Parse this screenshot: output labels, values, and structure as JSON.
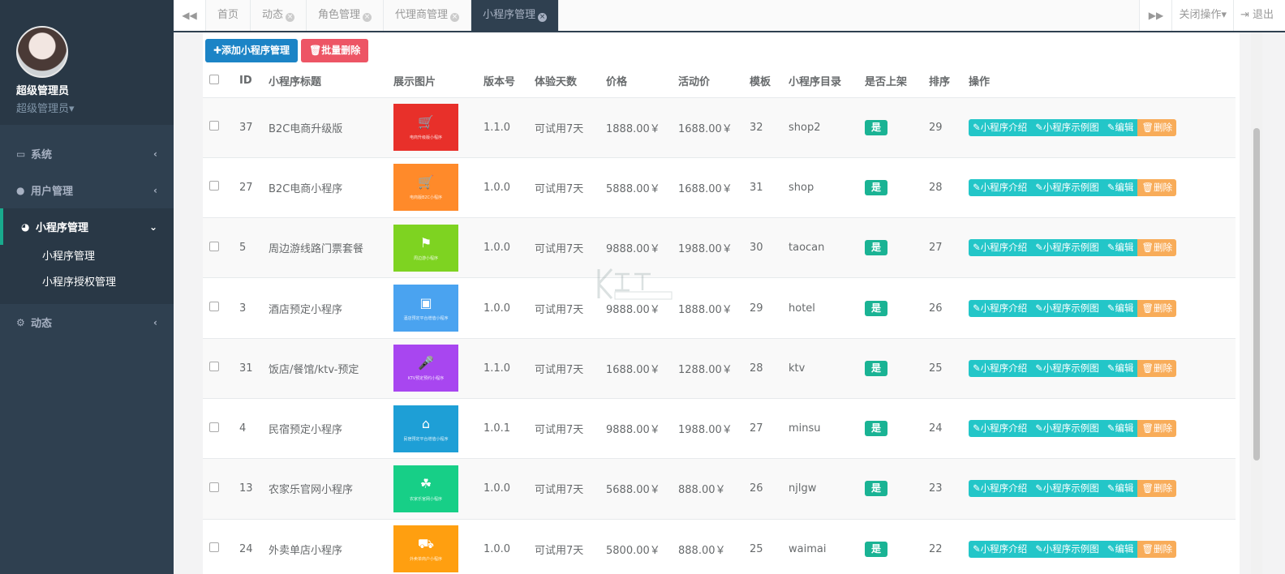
{
  "profile": {
    "name": "超级管理员",
    "role": "超级管理员▾"
  },
  "sidebar": {
    "items": [
      {
        "label": "系统",
        "icon": "monitor-icon"
      },
      {
        "label": "用户管理",
        "icon": "user-icon"
      },
      {
        "label": "小程序管理",
        "icon": "wechat-icon"
      },
      {
        "label": "动态",
        "icon": "cogs-icon"
      }
    ],
    "sub_items": [
      "小程序管理",
      "小程序授权管理"
    ]
  },
  "tabs": [
    {
      "label": "首页",
      "closable": false
    },
    {
      "label": "动态",
      "closable": true
    },
    {
      "label": "角色管理",
      "closable": true
    },
    {
      "label": "代理商管理",
      "closable": true
    },
    {
      "label": "小程序管理",
      "closable": true
    }
  ],
  "topbar": {
    "close_ops": "关闭操作▾",
    "logout": "退出"
  },
  "toolbar": {
    "add": "✚添加小程序管理",
    "batch_delete": "🗑批量删除"
  },
  "table": {
    "columns": [
      "ID",
      "小程序标题",
      "展示图片",
      "版本号",
      "体验天数",
      "价格",
      "活动价",
      "模板",
      "小程序目录",
      "是否上架",
      "排序",
      "操作"
    ],
    "actions": {
      "intro": "✎小程序介绍",
      "example": "✎小程序示例图",
      "edit": "✎编辑",
      "delete": "🗑删除"
    },
    "rows": [
      {
        "id": "37",
        "title": "B2C电商升级版",
        "thumb_color": "#e8302a",
        "thumb_caption": "电商升级版小程序",
        "version": "1.1.0",
        "trial": "可试用7天",
        "price": "1888.00￥",
        "promo": "1688.00￥",
        "template": "32",
        "dir": "shop2",
        "listed": "是",
        "sort": "29"
      },
      {
        "id": "27",
        "title": "B2C电商小程序",
        "thumb_color": "#ff8a2a",
        "thumb_caption": "电商版B2C小程序",
        "version": "1.0.0",
        "trial": "可试用7天",
        "price": "5888.00￥",
        "promo": "1688.00￥",
        "template": "31",
        "dir": "shop",
        "listed": "是",
        "sort": "28"
      },
      {
        "id": "5",
        "title": "周边游线路门票套餐",
        "thumb_color": "#7ed321",
        "thumb_caption": "周边游小程序",
        "version": "1.0.0",
        "trial": "可试用7天",
        "price": "9888.00￥",
        "promo": "1988.00￥",
        "template": "30",
        "dir": "taocan",
        "listed": "是",
        "sort": "27"
      },
      {
        "id": "3",
        "title": "酒店预定小程序",
        "thumb_color": "#4aa3f0",
        "thumb_caption": "酒店预定平台增值小程序",
        "version": "1.0.0",
        "trial": "可试用7天",
        "price": "9888.00￥",
        "promo": "1888.00￥",
        "template": "29",
        "dir": "hotel",
        "listed": "是",
        "sort": "26"
      },
      {
        "id": "31",
        "title": "饭店/餐馆/ktv-预定",
        "thumb_color": "#a846f0",
        "thumb_caption": "KTV预定预约小程序",
        "version": "1.1.0",
        "trial": "可试用7天",
        "price": "1688.00￥",
        "promo": "1288.00￥",
        "template": "28",
        "dir": "ktv",
        "listed": "是",
        "sort": "25"
      },
      {
        "id": "4",
        "title": "民宿预定小程序",
        "thumb_color": "#1e9fd6",
        "thumb_caption": "民宿预定平台增值小程序",
        "version": "1.0.1",
        "trial": "可试用7天",
        "price": "9888.00￥",
        "promo": "1988.00￥",
        "template": "27",
        "dir": "minsu",
        "listed": "是",
        "sort": "24"
      },
      {
        "id": "13",
        "title": "农家乐官网小程序",
        "thumb_color": "#17cf87",
        "thumb_caption": "农家乐官网小程序",
        "version": "1.0.0",
        "trial": "可试用7天",
        "price": "5688.00￥",
        "promo": "888.00￥",
        "template": "26",
        "dir": "njlgw",
        "listed": "是",
        "sort": "23"
      },
      {
        "id": "24",
        "title": "外卖单店小程序",
        "thumb_color": "#ff9f10",
        "thumb_caption": "外卖单商户小程序",
        "version": "1.0.0",
        "trial": "可试用7天",
        "price": "5800.00￥",
        "promo": "888.00￥",
        "template": "25",
        "dir": "waimai",
        "listed": "是",
        "sort": "22"
      }
    ]
  }
}
